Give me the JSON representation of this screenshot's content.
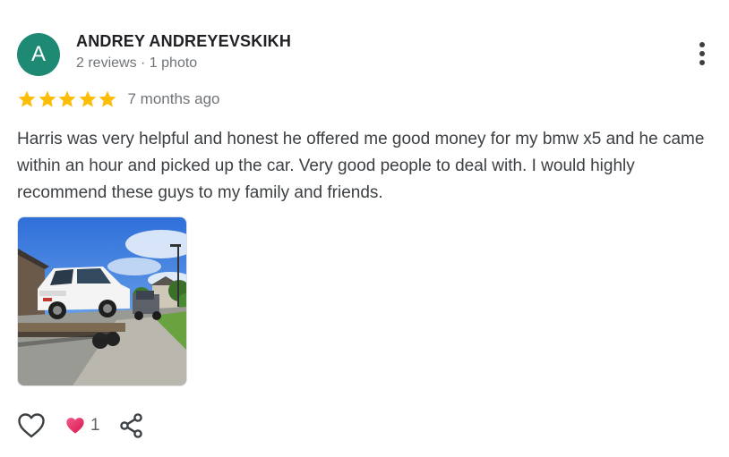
{
  "reviewer": {
    "avatar_initial": "A",
    "avatar_color": "#1e8a73",
    "name": "ANDREY ANDREYEVSKIKH",
    "meta": "2 reviews · 1 photo"
  },
  "menu": {
    "icon": "more-vertical-icon"
  },
  "rating": {
    "stars": 5,
    "max_stars": 5,
    "star_color": "#fbbc04",
    "time_ago": "7 months ago"
  },
  "review": {
    "text": "Harris was very helpful and honest he offered me good money for my bmw x5 and he came within an hour and picked up the car. Very good people to deal with. I would highly recommend these guys to my family and friends."
  },
  "photos": [
    {
      "icon": "review-photo"
    }
  ],
  "actions": {
    "like_icon": "heart-outline-icon",
    "reaction_icon": "heart-filled-icon",
    "reaction_color": "#e8245f",
    "reaction_count": "1",
    "share_icon": "share-icon"
  }
}
